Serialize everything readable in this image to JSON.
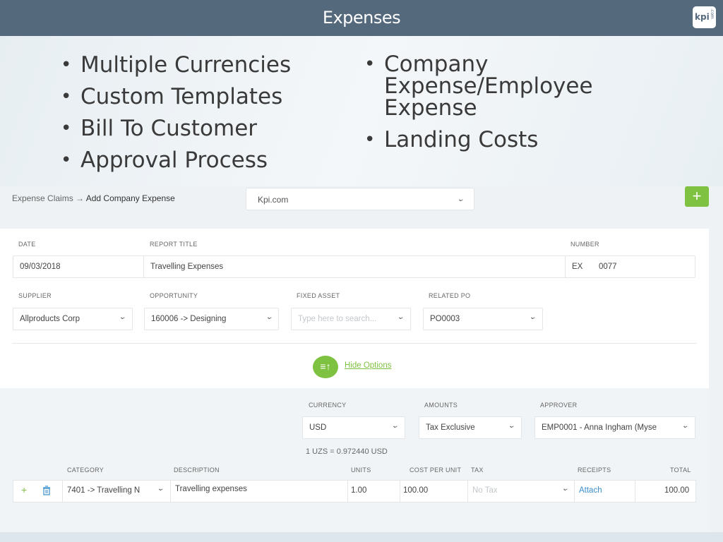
{
  "slide": {
    "title": "Expenses",
    "logo": {
      "text": "kpi",
      "sub": ".com"
    },
    "bullets_left": [
      "Multiple Currencies",
      "Custom Templates",
      "Bill To Customer",
      "Approval Process"
    ],
    "bullets_right": [
      "Company Expense/Employee Expense",
      "Landing Costs"
    ]
  },
  "app": {
    "breadcrumb": {
      "parent": "Expense Claims",
      "separator": "→",
      "current": "Add Company Expense"
    },
    "company_select": "Kpi.com",
    "add_button": "+",
    "form": {
      "date": {
        "label": "DATE",
        "value": "09/03/2018"
      },
      "report_title": {
        "label": "REPORT TITLE",
        "value": "Travelling Expenses"
      },
      "number": {
        "label": "NUMBER",
        "prefix": "EX",
        "value": "0077"
      },
      "supplier": {
        "label": "SUPPLIER",
        "value": "Allproducts Corp"
      },
      "opportunity": {
        "label": "OPPORTUNITY",
        "value": "160006 -> Designing"
      },
      "fixed_asset": {
        "label": "FIXED ASSET",
        "placeholder": "Type here to search..."
      },
      "related_po": {
        "label": "RELATED PO",
        "value": "PO0003"
      },
      "hide_options": "Hide Options"
    },
    "options": {
      "currency": {
        "label": "CURRENCY",
        "value": "USD"
      },
      "amounts": {
        "label": "AMOUNTS",
        "value": "Tax Exclusive"
      },
      "approver": {
        "label": "APPROVER",
        "value": "EMP0001 - Anna Ingham (Myse"
      },
      "rate_text": "1 UZS = 0.972440 USD"
    },
    "lines": {
      "headers": {
        "category": "CATEGORY",
        "description": "DESCRIPTION",
        "units": "UNITS",
        "cost_per_unit": "COST PER UNIT",
        "tax": "TAX",
        "receipts": "RECEIPTS",
        "total": "TOTAL"
      },
      "row": {
        "category": "7401 -> Travelling N",
        "description": "Travelling expenses",
        "units": "1.00",
        "cost_per_unit": "100.00",
        "tax_placeholder": "No Tax",
        "receipts": "Attach",
        "total": "100.00"
      }
    }
  }
}
